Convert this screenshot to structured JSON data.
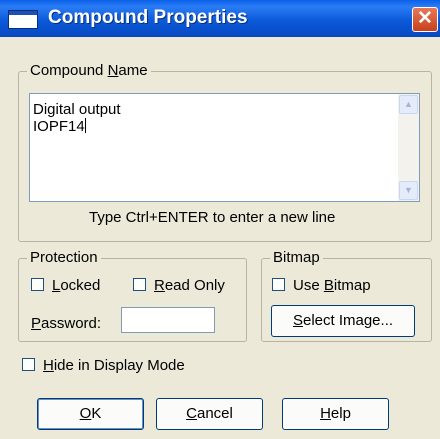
{
  "window": {
    "title": "Compound Properties",
    "close_glyph": "✕"
  },
  "compound_name": {
    "legend_prefix": "Compound ",
    "legend_accel": "N",
    "legend_rest": "ame",
    "lines": [
      "Digital output",
      "IOPF14"
    ],
    "hint": "Type Ctrl+ENTER to enter a new line"
  },
  "protection": {
    "legend": "Protection",
    "locked": {
      "accel": "L",
      "rest": "ocked",
      "checked": false
    },
    "read_only": {
      "accel": "R",
      "rest": "ead Only",
      "checked": false
    },
    "password_accel": "P",
    "password_rest": "assword:",
    "password_value": ""
  },
  "bitmap": {
    "legend": "Bitmap",
    "use_bitmap": {
      "prefix": "Use ",
      "accel": "B",
      "rest": "itmap",
      "checked": false
    },
    "select_accel": "S",
    "select_rest": "elect Image..."
  },
  "hide_in_display": {
    "accel": "H",
    "rest": "ide in Display Mode",
    "checked": false
  },
  "buttons": {
    "ok": {
      "accel": "O",
      "rest": "K"
    },
    "cancel": {
      "accel": "C",
      "rest": "ancel"
    },
    "help": {
      "accel": "H",
      "rest": "elp"
    }
  },
  "icons": {
    "title": "window-icon",
    "scroll_up": "▲",
    "scroll_down": "▼"
  }
}
